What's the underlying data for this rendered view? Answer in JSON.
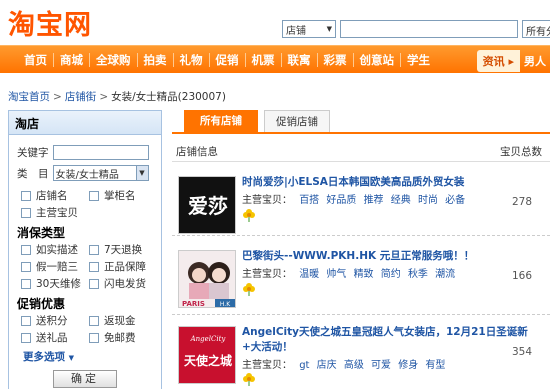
{
  "header": {
    "logo": "淘宝网",
    "search_scope": "店铺",
    "search_value": "",
    "search_scope2": "所有分"
  },
  "nav": {
    "items": [
      "首页",
      "商城",
      "全球购",
      "拍卖",
      "礼物",
      "促销",
      "机票",
      "联寓",
      "彩票",
      "创意站",
      "学生"
    ],
    "right_tab1": "资讯",
    "right_tab1_arrow": "▸",
    "right_tab2": "男人"
  },
  "breadcrumb": {
    "home": "淘宝首页",
    "shops": "店铺街",
    "current": "女装/女士精品(230007)",
    "sep": ">"
  },
  "sidebar": {
    "title": "淘店",
    "keyword_label": "关键字",
    "category_label": "类　目",
    "category_value": "女装/女士精品",
    "opt_shopname": "店铺名",
    "opt_keeper": "掌柜名",
    "opt_mainitem": "主营宝贝",
    "xiaobao_title": "消保类型",
    "xiaobao": [
      "如实描述",
      "7天退换",
      "假一赔三",
      "正品保障",
      "30天维修",
      "闪电发货"
    ],
    "promo_title": "促销优惠",
    "promo": [
      "送积分",
      "返现金",
      "送礼品",
      "免邮费"
    ],
    "more": "更多选项",
    "more_arrow": "▼",
    "ok_button": "确定"
  },
  "tabs": {
    "all": "所有店铺",
    "promo": "促销店铺"
  },
  "list": {
    "col_info": "店铺信息",
    "col_total": "宝贝总数",
    "main_label": "主营宝贝：",
    "shops": [
      {
        "name": "时尚爱莎|小ELSA日本韩国欧美高品质外贸女装",
        "tags": [
          "百搭",
          "好品质",
          "推荐",
          "经典",
          "时尚",
          "必备"
        ],
        "count": "278"
      },
      {
        "name": "巴黎街头--WWW.PKH.HK 元旦正常服务哦！！",
        "tags": [
          "温暖",
          "帅气",
          "精致",
          "简约",
          "秋季",
          "潮流"
        ],
        "count": "166"
      },
      {
        "name": "AngelCity天使之城五皇冠超人气女装店，12月21日圣诞新+大活动！",
        "tags": [
          "gt",
          "店庆",
          "高级",
          "可爱",
          "修身",
          "有型"
        ],
        "count": "354"
      }
    ],
    "thumb1_text": "爱莎",
    "thumb2_text": "PARIS",
    "thumb2_badge": "H.K",
    "thumb3_text": "天使之城",
    "thumb3_brand": "AngelCity"
  }
}
